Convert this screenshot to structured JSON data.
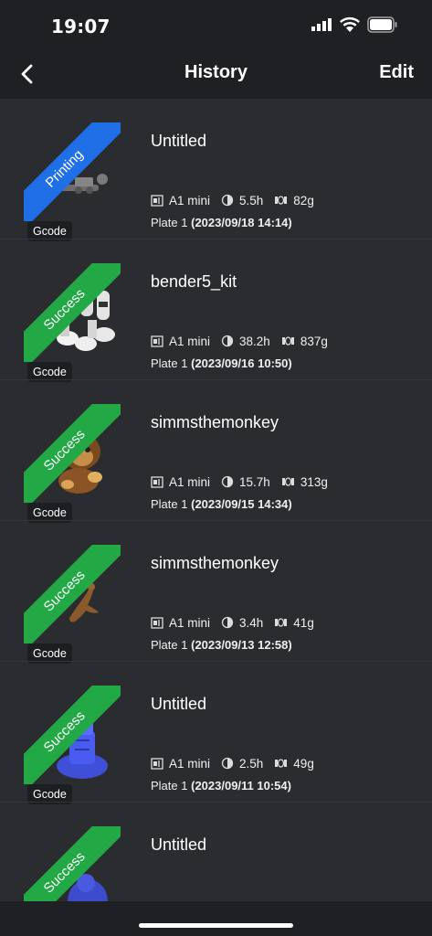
{
  "status_bar": {
    "time": "19:07"
  },
  "nav": {
    "title": "History",
    "edit_label": "Edit",
    "back_icon": "chevron-left-icon"
  },
  "items": [
    {
      "status": "Printing",
      "status_color": "#1f6fe6",
      "badge": "Gcode",
      "name": "Untitled",
      "printer": "A1 mini",
      "duration": "5.5h",
      "weight": "82g",
      "plate": "Plate 1",
      "date": "(2023/09/18 14:14)"
    },
    {
      "status": "Success",
      "status_color": "#22a844",
      "badge": "Gcode",
      "name": "bender5_kit",
      "printer": "A1 mini",
      "duration": "38.2h",
      "weight": "837g",
      "plate": "Plate 1",
      "date": "(2023/09/16 10:50)"
    },
    {
      "status": "Success",
      "status_color": "#22a844",
      "badge": "Gcode",
      "name": "simmsthemonkey",
      "printer": "A1 mini",
      "duration": "15.7h",
      "weight": "313g",
      "plate": "Plate 1",
      "date": "(2023/09/15 14:34)"
    },
    {
      "status": "Success",
      "status_color": "#22a844",
      "badge": "Gcode",
      "name": "simmsthemonkey",
      "printer": "A1 mini",
      "duration": "3.4h",
      "weight": "41g",
      "plate": "Plate 1",
      "date": "(2023/09/13 12:58)"
    },
    {
      "status": "Success",
      "status_color": "#22a844",
      "badge": "Gcode",
      "name": "Untitled",
      "printer": "A1 mini",
      "duration": "2.5h",
      "weight": "49g",
      "plate": "Plate 1",
      "date": "(2023/09/11 10:54)"
    },
    {
      "status": "Success",
      "status_color": "#22a844",
      "name": "Untitled"
    }
  ]
}
